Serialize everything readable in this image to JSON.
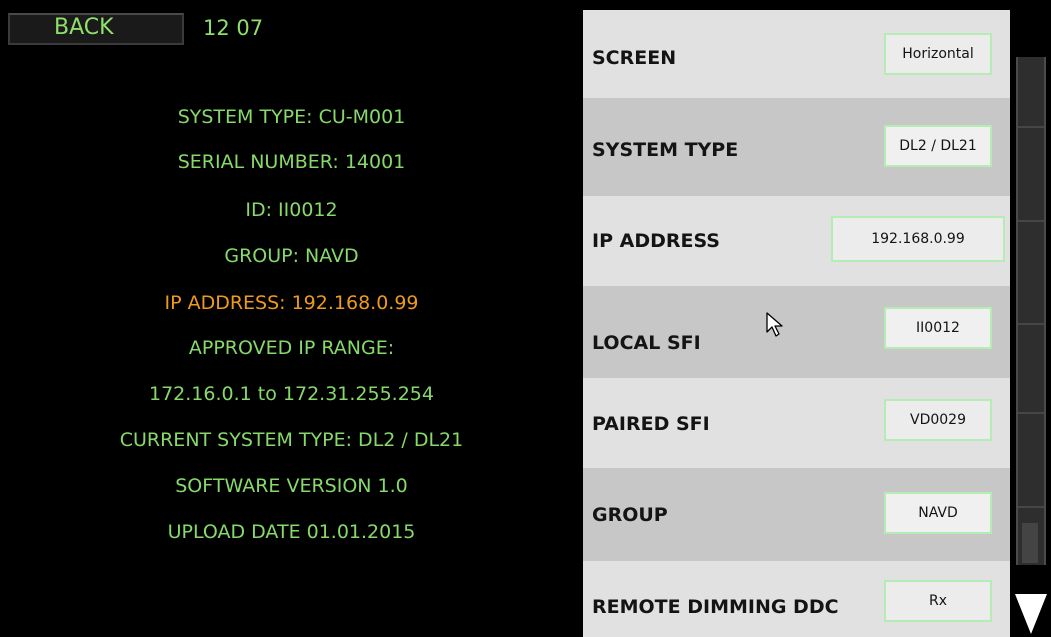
{
  "header": {
    "back_label": "BACK",
    "time": "12 07"
  },
  "info": {
    "system_type": "SYSTEM TYPE: CU-M001",
    "serial_number": "SERIAL NUMBER: 14001",
    "id": "ID: II0012",
    "group": "GROUP: NAVD",
    "ip_address": "IP ADDRESS: 192.168.0.99",
    "approved_ip_range_label": "APPROVED IP RANGE:",
    "approved_ip_range": "172.16.0.1 to 172.31.255.254",
    "current_system_type": "CURRENT SYSTEM TYPE: DL2 / DL21",
    "software_version": "SOFTWARE VERSION 1.0",
    "upload_date": "UPLOAD DATE 01.01.2015"
  },
  "colors": {
    "info_text": "#86d96a",
    "warning_text": "#f09a1c",
    "field_border": "#b4ecb3"
  },
  "settings": [
    {
      "label": "SCREEN",
      "value": "Horizontal"
    },
    {
      "label": "SYSTEM TYPE",
      "value": "DL2 / DL21"
    },
    {
      "label": "IP ADDRESS",
      "value": "192.168.0.99"
    },
    {
      "label": "LOCAL SFI",
      "value": "II0012"
    },
    {
      "label": "PAIRED SFI",
      "value": "VD0029"
    },
    {
      "label": "GROUP",
      "value": "NAVD"
    },
    {
      "label": "REMOTE DIMMING DDC",
      "value": "Rx"
    }
  ],
  "icons": {
    "scroll_down": "triangle-down-icon",
    "cursor": "mouse-pointer-icon"
  }
}
